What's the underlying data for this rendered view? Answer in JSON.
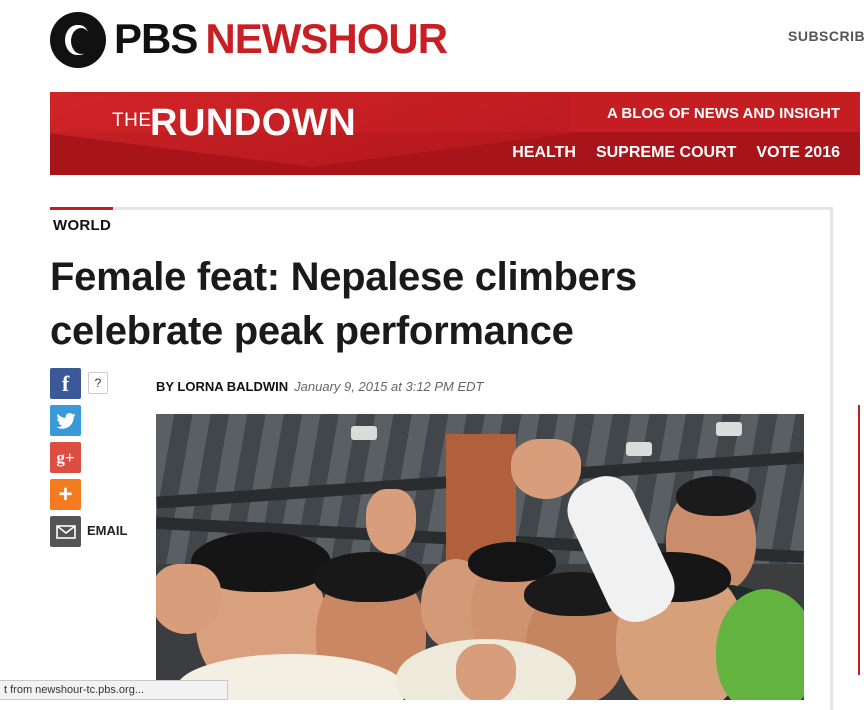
{
  "header": {
    "logo_pbs": "PBS",
    "logo_newshour": "NEWSHOUR",
    "subscribe_label": "SUBSCRIBE"
  },
  "banner": {
    "the": "THE",
    "rundown": "RUNDOWN",
    "tagline": "A BLOG OF NEWS AND INSIGHT",
    "nav": [
      "HEALTH",
      "SUPREME COURT",
      "VOTE 2016"
    ]
  },
  "article": {
    "category": "WORLD",
    "headline": "Female feat: Nepalese climbers celebrate peak performance",
    "byline": "BY LORNA BALDWIN",
    "date": "January 9, 2015 at 3:12 PM EDT"
  },
  "social": {
    "facebook_count": "?",
    "email_label": "EMAIL",
    "icons": [
      "facebook-icon",
      "twitter-icon",
      "google-plus-icon",
      "share-plus-icon",
      "email-icon"
    ]
  },
  "status_bar": {
    "text": "t from newshour-tc.pbs.org..."
  },
  "colors": {
    "brand_red": "#c41e22",
    "facebook": "#3b5998",
    "twitter": "#3a9ad9",
    "google_plus": "#dc4e41",
    "share": "#f47b20"
  }
}
